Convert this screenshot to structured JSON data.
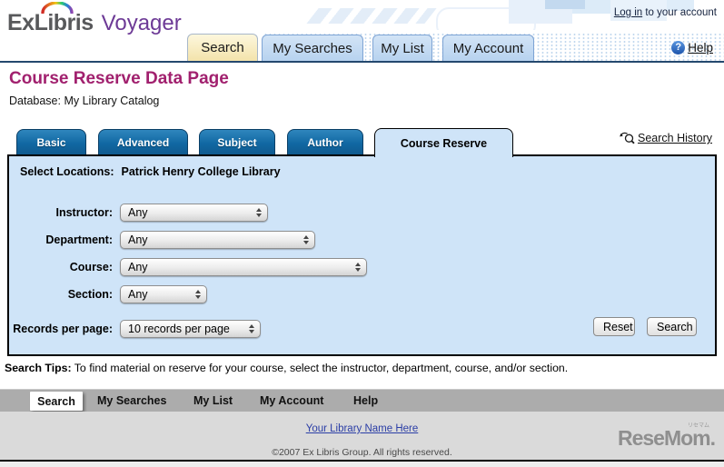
{
  "brand": {
    "exlibris": "ExLibris",
    "voyager": "Voyager"
  },
  "header": {
    "login_link": "Log in",
    "login_suffix": " to your account",
    "tabs": [
      {
        "label": "Search",
        "active": true
      },
      {
        "label": "My Searches",
        "active": false
      },
      {
        "label": "My List",
        "active": false
      },
      {
        "label": "My Account",
        "active": false
      }
    ],
    "help_label": "Help",
    "help_icon_glyph": "?"
  },
  "page": {
    "title": "Course Reserve Data Page",
    "database_label": "Database:",
    "database_value": "My Library Catalog"
  },
  "search_panel": {
    "tabs": [
      "Basic",
      "Advanced",
      "Subject",
      "Author"
    ],
    "active_tab": "Course Reserve",
    "search_history_label": "Search History",
    "select_locations_label": "Select Locations:",
    "select_locations_value": "Patrick Henry College Library",
    "fields": [
      {
        "label": "Instructor:",
        "value": "Any"
      },
      {
        "label": "Department:",
        "value": "Any"
      },
      {
        "label": "Course:",
        "value": "Any"
      },
      {
        "label": "Section:",
        "value": "Any"
      }
    ],
    "records_per_page_label": "Records per page:",
    "records_per_page_value": "10 records per page",
    "reset_label": "Reset",
    "search_label": "Search"
  },
  "tips": {
    "label": "Search Tips:",
    "text": " To find material on reserve for your course, select the instructor, department, course, and/or section."
  },
  "bottom_nav": {
    "items": [
      {
        "label": "Search",
        "active": true
      },
      {
        "label": "My Searches",
        "active": false
      },
      {
        "label": "My List",
        "active": false
      },
      {
        "label": "My Account",
        "active": false
      },
      {
        "label": "Help",
        "active": false
      }
    ]
  },
  "footer": {
    "library_link": "Your Library Name Here",
    "copyright": "©2007 Ex Libris Group. All rights reserved."
  },
  "watermark": {
    "text": "ReseMom.",
    "tiny": "リセマム"
  },
  "colors": {
    "brand_gray": "#58595b",
    "brand_purple": "#6d3a96",
    "title_magenta": "#a1206e",
    "tab_blue": "#1168a3",
    "tab_blue_dark": "#0b3f66",
    "panel_blue": "#cfe4f8",
    "header_line_navy": "#24486e",
    "active_tab_cream": "#f3e3ab",
    "link_blue": "#2b3ea6",
    "nav_gray": "#acacac",
    "footer_gray": "#dadada"
  }
}
